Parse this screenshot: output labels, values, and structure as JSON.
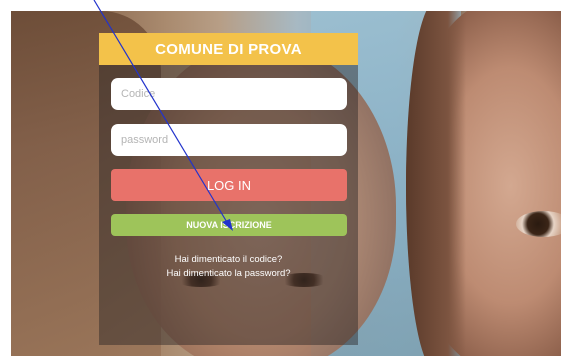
{
  "login": {
    "title": "COMUNE DI PROVA",
    "code_placeholder": "Codice",
    "password_placeholder": "password",
    "login_button": "LOG IN",
    "new_registration_button": "NUOVA ISCRIZIONE",
    "forgot_code_link": "Hai dimenticato il codice?",
    "forgot_password_link": "Hai dimenticato la password?"
  },
  "colors": {
    "header": "#f3c24a",
    "login_button": "#e8726a",
    "new_registration_button": "#9ec45a",
    "annotation_arrow": "#2233cc"
  }
}
